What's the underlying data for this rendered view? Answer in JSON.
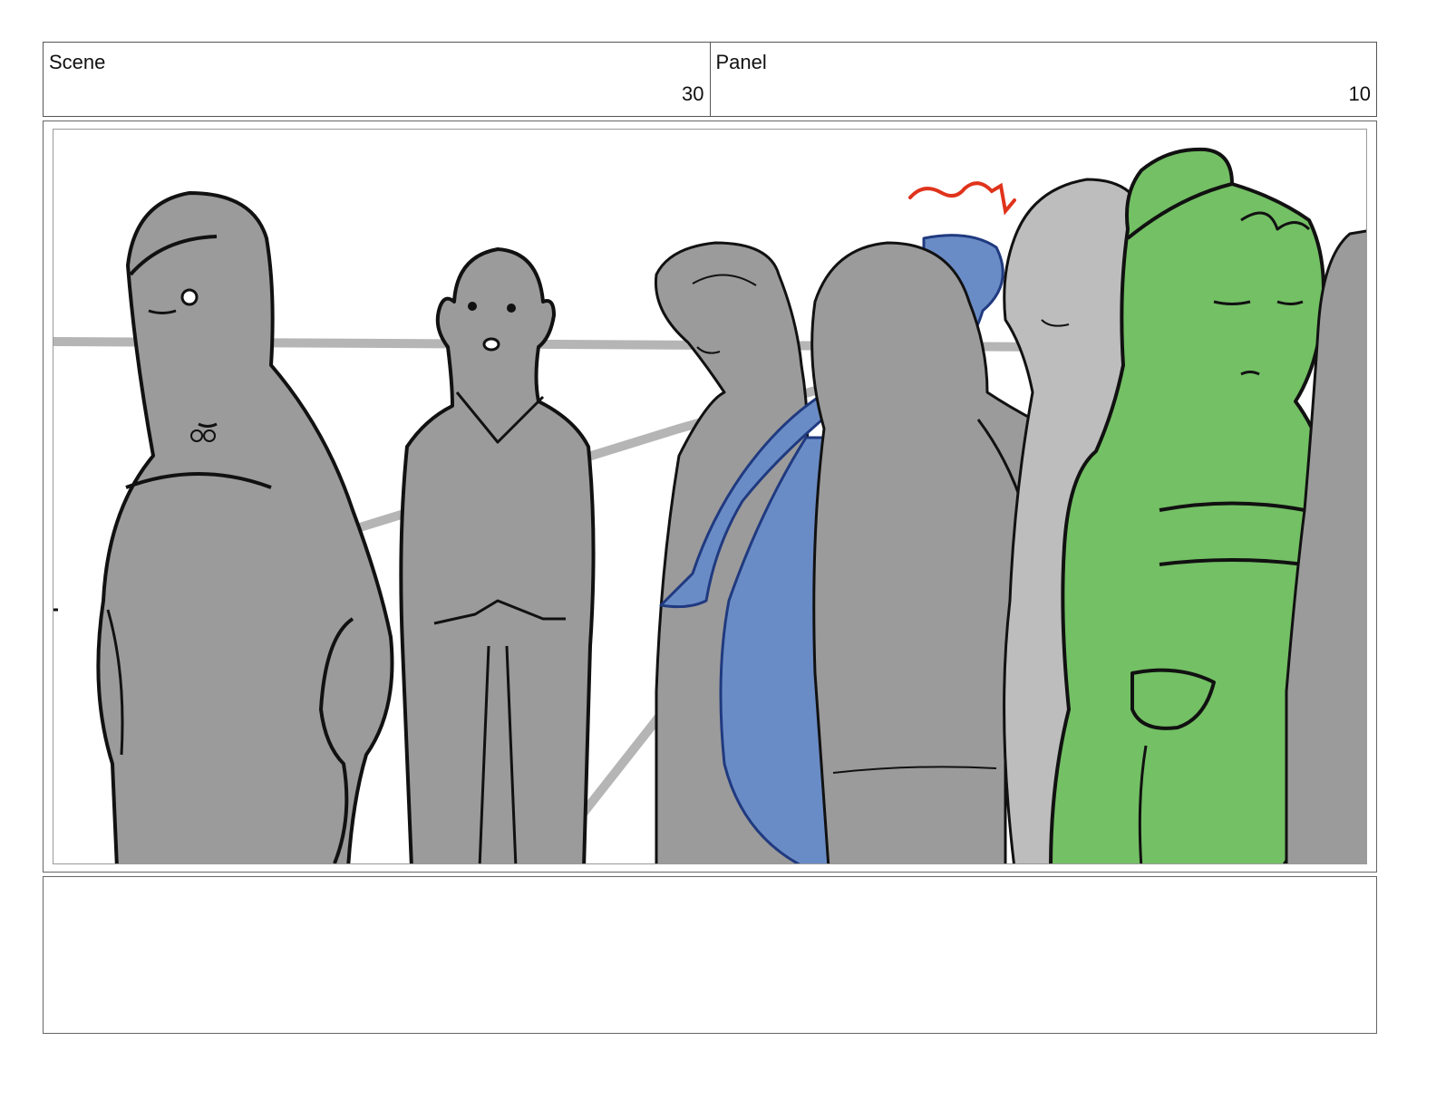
{
  "header": {
    "scene_label": "Scene",
    "scene_number": "30",
    "panel_label": "Panel",
    "panel_number": "10"
  },
  "frame": {
    "description_icons": [
      "line-of-figures-sketch",
      "woman-in-strapless-dress",
      "bald-man",
      "curly-haired-woman",
      "blue-figure",
      "hugging-figure",
      "light-gray-figure",
      "green-highlighted-woman",
      "red-scribble-mark"
    ],
    "colors": {
      "sketch_fill_gray": "#9b9b9b",
      "light_gray": "#bdbdbd",
      "highlight_blue": "#6a8cc6",
      "highlight_green": "#74c065",
      "scribble_red": "#e0331c",
      "line_black": "#111111",
      "wall_line": "#b5b5b5"
    }
  },
  "notes": {
    "text": ""
  }
}
